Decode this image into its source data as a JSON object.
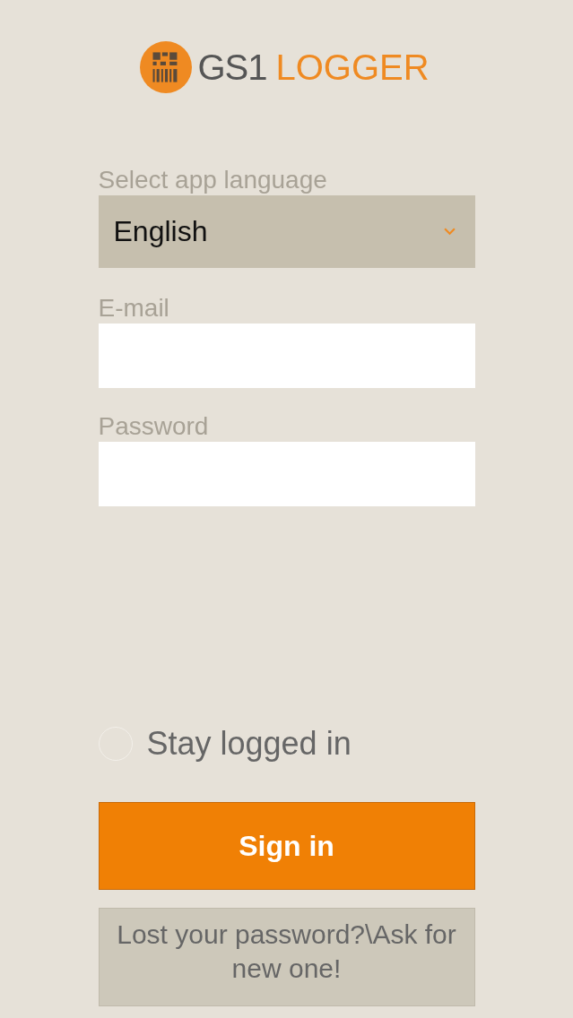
{
  "logo": {
    "brand": "GS1",
    "product": "LOGGER"
  },
  "language": {
    "label": "Select app language",
    "value": "English"
  },
  "email": {
    "label": "E-mail"
  },
  "password": {
    "label": "Password"
  },
  "stay_logged_in": {
    "label": "Stay logged in",
    "checked": false
  },
  "sign_in_button": "Sign in",
  "lost_password_button": "Lost your password?\\Ask for new one!"
}
